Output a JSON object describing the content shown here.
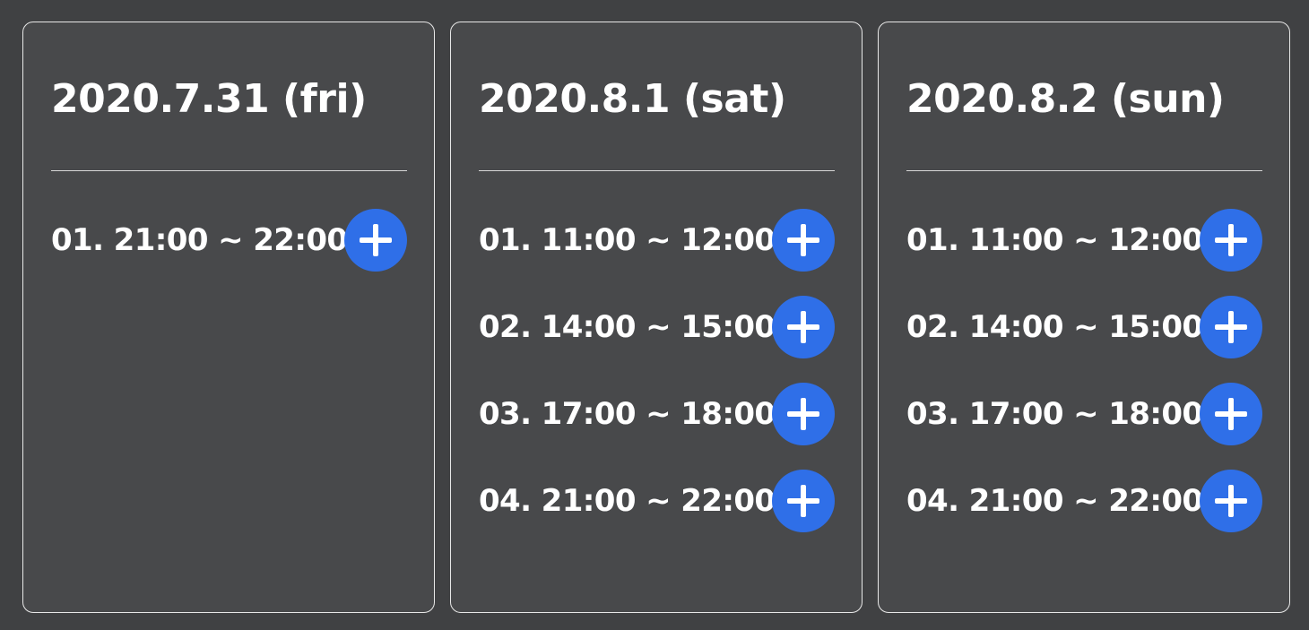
{
  "colors": {
    "page_background": "#404143",
    "card_background": "#48494b",
    "card_border": "#e8e8e8",
    "text": "#ffffff",
    "add_button": "#2f6fe8"
  },
  "days": [
    {
      "date": "2020.7.31 (fri)",
      "slots": [
        {
          "label": "01. 21:00 ~ 22:00",
          "icon": "plus-icon"
        }
      ]
    },
    {
      "date": "2020.8.1 (sat)",
      "slots": [
        {
          "label": "01. 11:00 ~ 12:00",
          "icon": "plus-icon"
        },
        {
          "label": "02. 14:00 ~ 15:00",
          "icon": "plus-icon"
        },
        {
          "label": "03. 17:00 ~ 18:00",
          "icon": "plus-icon"
        },
        {
          "label": "04. 21:00 ~ 22:00",
          "icon": "plus-icon"
        }
      ]
    },
    {
      "date": "2020.8.2 (sun)",
      "slots": [
        {
          "label": "01. 11:00 ~ 12:00",
          "icon": "plus-icon"
        },
        {
          "label": "02. 14:00 ~ 15:00",
          "icon": "plus-icon"
        },
        {
          "label": "03. 17:00 ~ 18:00",
          "icon": "plus-icon"
        },
        {
          "label": "04. 21:00 ~ 22:00",
          "icon": "plus-icon"
        }
      ]
    }
  ]
}
